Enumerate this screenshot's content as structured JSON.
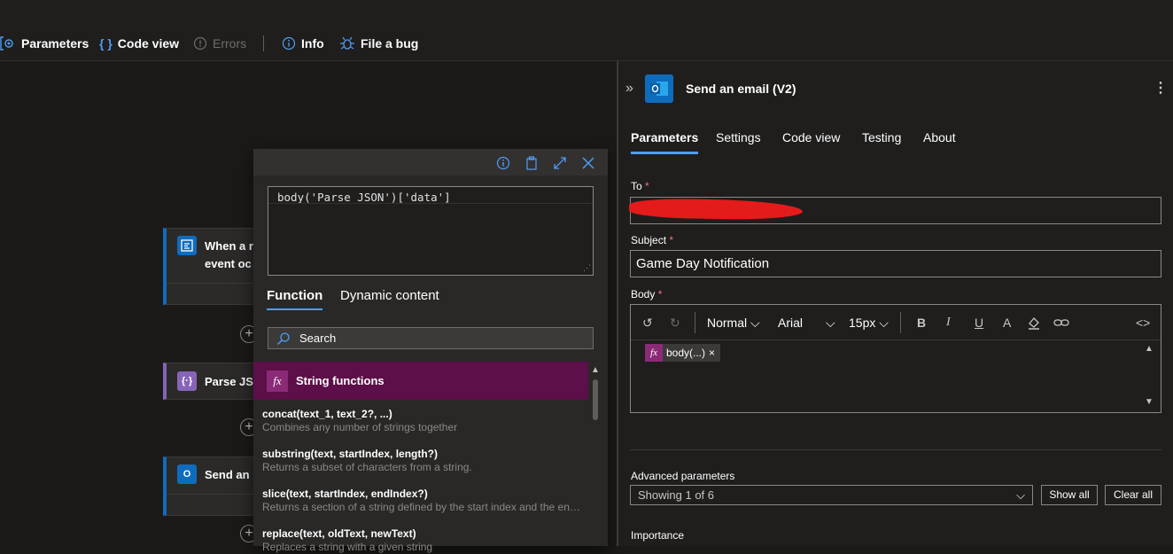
{
  "toolbar": {
    "parameters": "Parameters",
    "code_view": "Code view",
    "errors": "Errors",
    "info": "Info",
    "file_bug": "File a bug"
  },
  "canvas": {
    "trigger_label_1": "When a r",
    "trigger_label_2": "event oc",
    "parse_label": "Parse JSC",
    "send_label": "Send an"
  },
  "expression_panel": {
    "expression": "body('Parse_JSON')['data']",
    "tabs": [
      "Function",
      "Dynamic content"
    ],
    "active_tab": "Function",
    "search_placeholder": "Search",
    "category": "String functions",
    "functions": [
      {
        "name": "concat(text_1, text_2?, ...)",
        "desc": "Combines any number of strings together"
      },
      {
        "name": "substring(text, startIndex, length?)",
        "desc": "Returns a subset of characters from a string."
      },
      {
        "name": "slice(text, startIndex, endIndex?)",
        "desc": "Returns a section of a string defined by the start index and the end index."
      },
      {
        "name": "replace(text, oldText, newText)",
        "desc": "Replaces a string with a given string"
      }
    ]
  },
  "details": {
    "title": "Send an email (V2)",
    "tabs": [
      "Parameters",
      "Settings",
      "Code view",
      "Testing",
      "About"
    ],
    "active_tab": "Parameters",
    "to_label": "To",
    "subject_label": "Subject",
    "subject_value": "Game Day Notification",
    "body_label": "Body",
    "required_mark": "*",
    "format": "Normal",
    "font": "Arial",
    "size": "15px",
    "token": "body(...)",
    "advanced_label": "Advanced parameters",
    "advanced_value": "Showing 1 of 6",
    "show_all": "Show all",
    "clear_all": "Clear all",
    "importance_label": "Importance"
  },
  "colors": {
    "accent": "#4f9df6",
    "function_category": "#5c0f48",
    "redaction": "#e41b1b"
  }
}
